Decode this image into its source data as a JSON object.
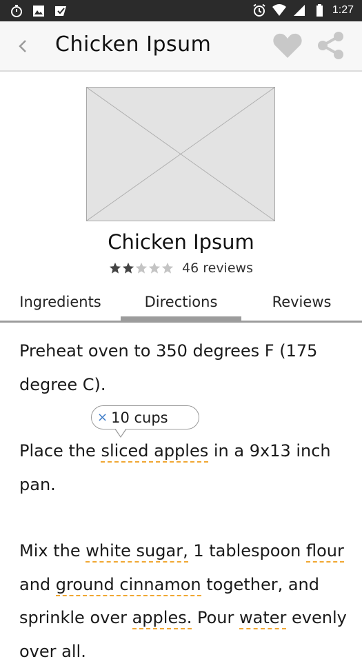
{
  "status_bar": {
    "time": "1:27",
    "left_icons": [
      "stopwatch-icon",
      "image-icon",
      "check-icon"
    ],
    "right_icons": [
      "alarm-icon",
      "wifi-icon",
      "signal-icon",
      "battery-icon"
    ]
  },
  "app_bar": {
    "back_icon": "chevron-left-icon",
    "title": "Chicken Ipsum",
    "actions": [
      "heart-icon",
      "share-icon"
    ]
  },
  "recipe": {
    "image": "placeholder-image",
    "title": "Chicken Ipsum",
    "rating": 2,
    "rating_max": 5,
    "reviews": "46 reviews"
  },
  "tabs": {
    "items": [
      "Ingredients",
      "Directions",
      "Reviews"
    ],
    "active": "Directions"
  },
  "directions": {
    "step1": "Preheat oven to 350 degrees F (175 degree C).",
    "step2": {
      "a": "Place the ",
      "ing1": "sliced apples",
      "b": " in a 9x13 inch pan."
    },
    "step3": {
      "a": "Mix the ",
      "ing1": "white sugar,",
      "b": " 1 tablespoon ",
      "ing2": "flour",
      "c": " and ",
      "ing3": "ground cinnamon",
      "d": " together, and sprinkle over ",
      "ing4": "apples.",
      "e": " Pour ",
      "ing5": "water",
      "f": " evenly over all."
    }
  },
  "tooltip": {
    "close": "×",
    "text": "10 cups"
  },
  "colors": {
    "status_bar": "#2b2b2b",
    "app_bar": "#f7f7f7",
    "ingredient_underline": "#f0a732",
    "tab_indicator": "#9c9c9c",
    "tooltip_close": "#3b79c6"
  }
}
